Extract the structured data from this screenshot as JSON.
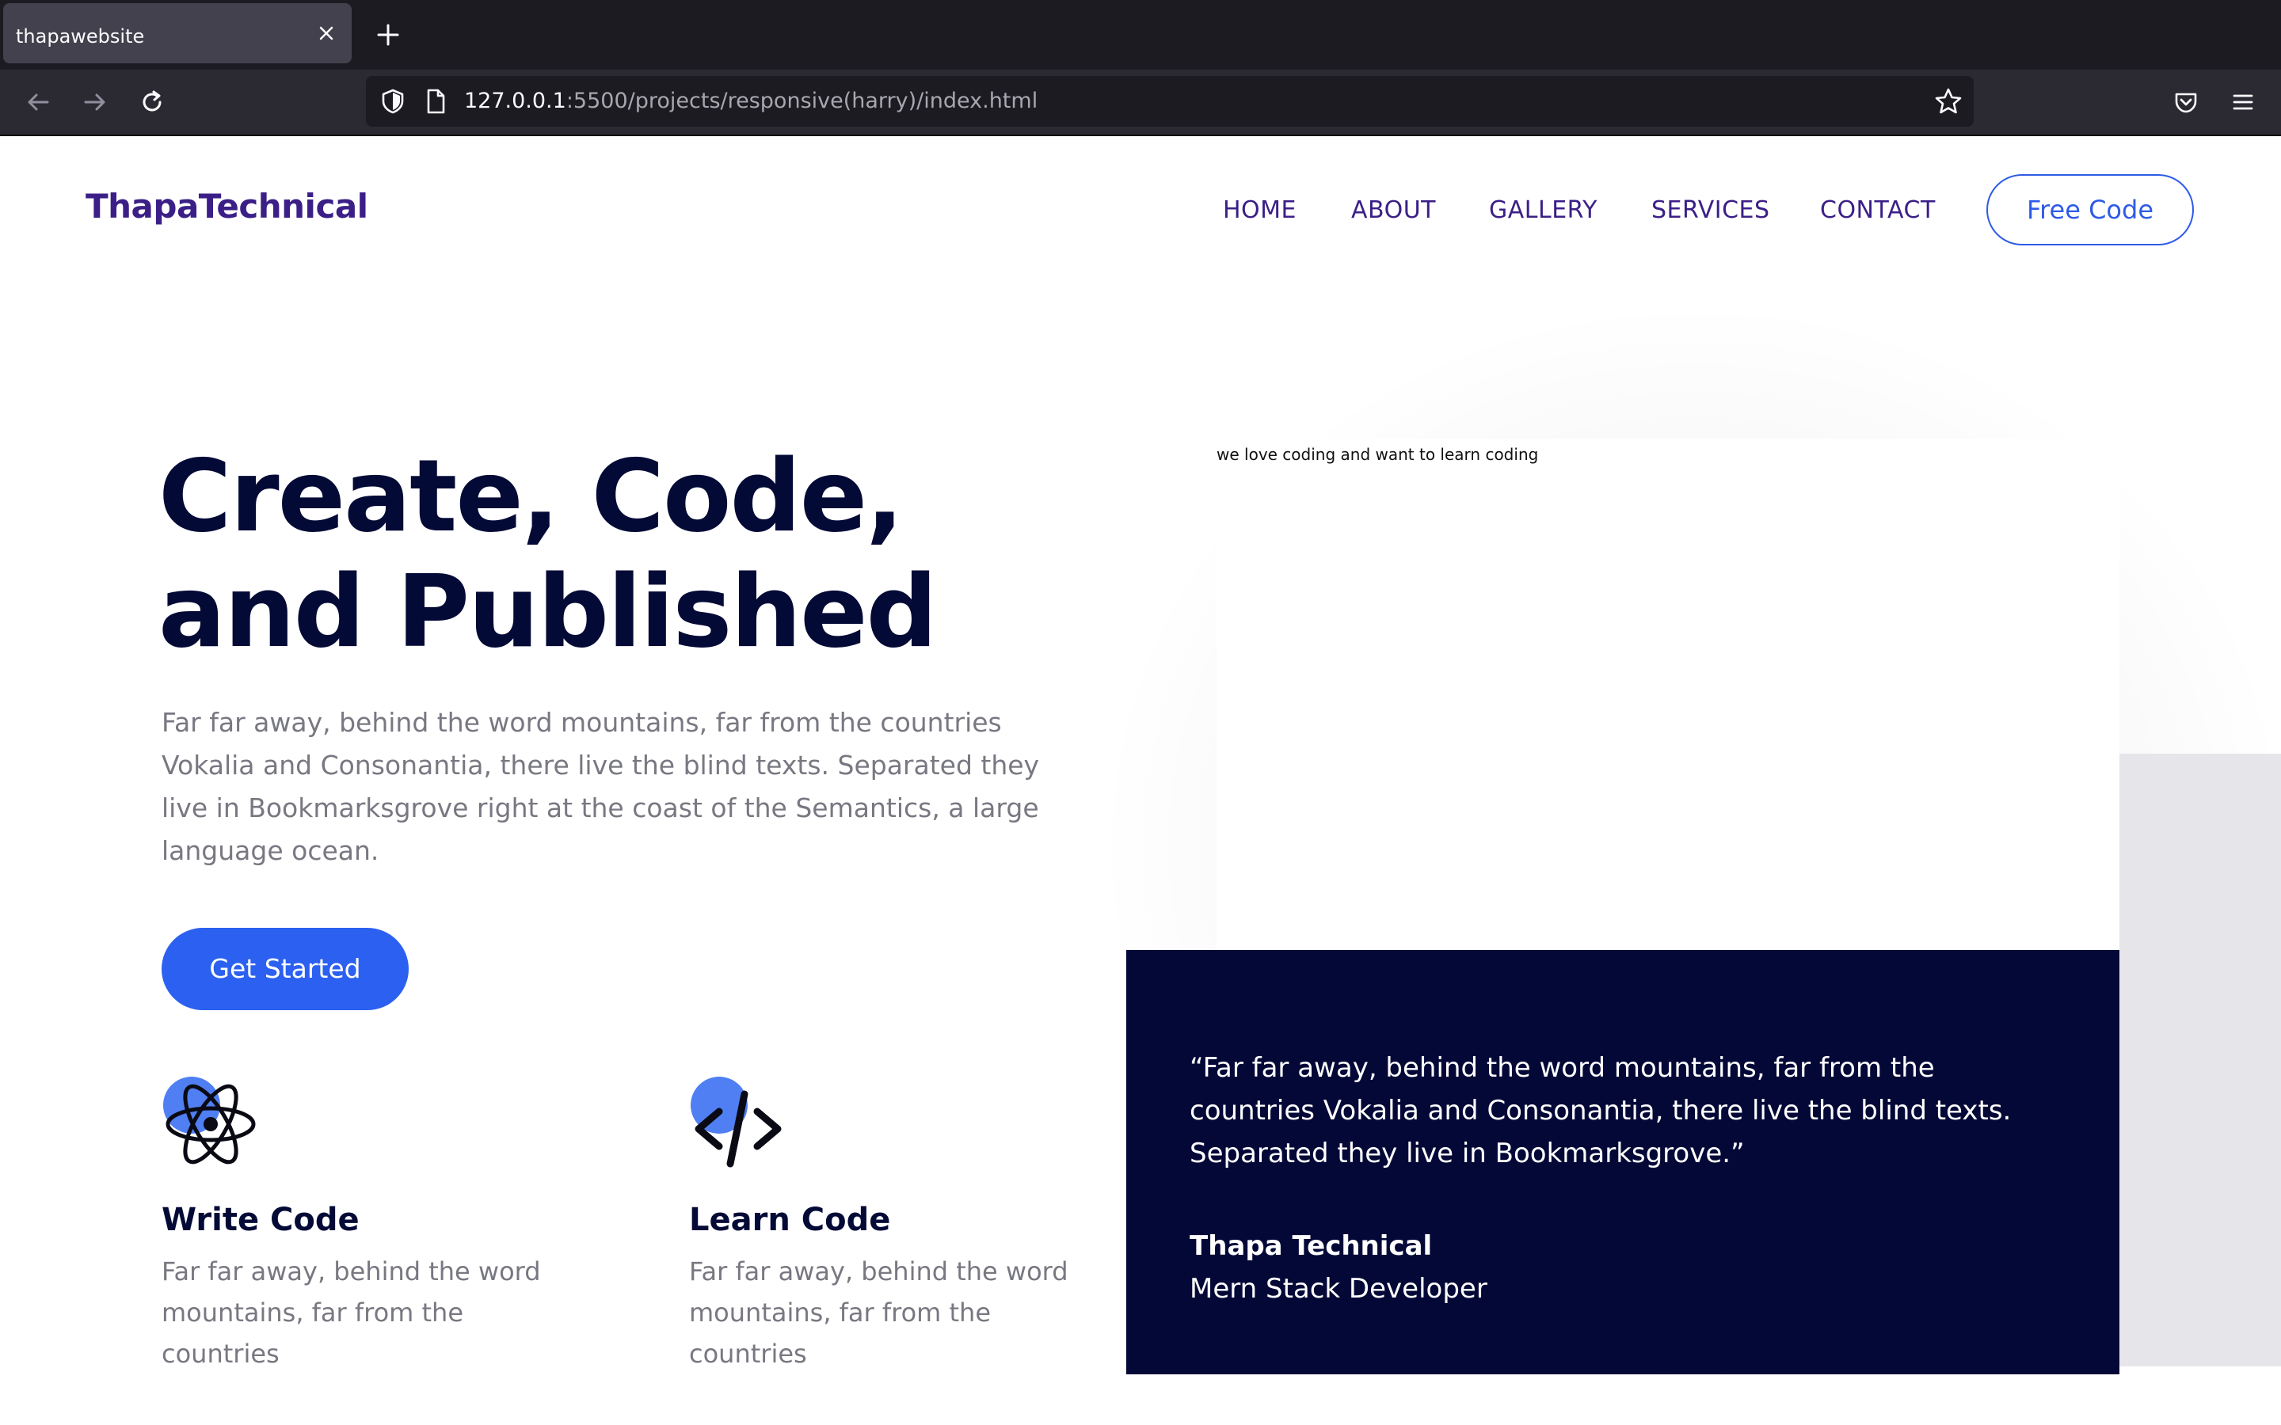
{
  "browser": {
    "tab_title": "thapawebsite",
    "url_host": "127.0.0.1",
    "url_rest": ":5500/projects/responsive(harry)/index.html"
  },
  "header": {
    "brand": "ThapaTechnical",
    "nav": [
      "HOME",
      "ABOUT",
      "GALLERY",
      "SERVICES",
      "CONTACT"
    ],
    "cta": "Free Code"
  },
  "hero": {
    "title": "Create, Code, and Published",
    "description": "Far far away, behind the word mountains, far from the countries Vokalia and Consonantia, there live the blind texts. Separated they live in Bookmarksgrove right at the coast of the Semantics, a large language ocean.",
    "button": "Get Started"
  },
  "features": [
    {
      "icon": "atom-icon",
      "title": "Write Code",
      "text": "Far far away, behind the word mountains, far from the countries"
    },
    {
      "icon": "code-icon",
      "title": "Learn Code",
      "text": "Far far away, behind the word mountains, far from the countries"
    }
  ],
  "image_card": {
    "caption": "we love coding and want to learn coding"
  },
  "testimonial": {
    "quote": "“Far far away, behind the word mountains, far from the countries Vokalia and Consonantia, there live the blind texts. Separated they live in Bookmarksgrove.”",
    "name": "Thapa Technical",
    "role": "Mern Stack Developer"
  },
  "colors": {
    "brand": "#3b1f87",
    "primary": "#2b60f0",
    "dark": "#040a36",
    "quote_bg": "#030837",
    "muted": "#787882"
  }
}
